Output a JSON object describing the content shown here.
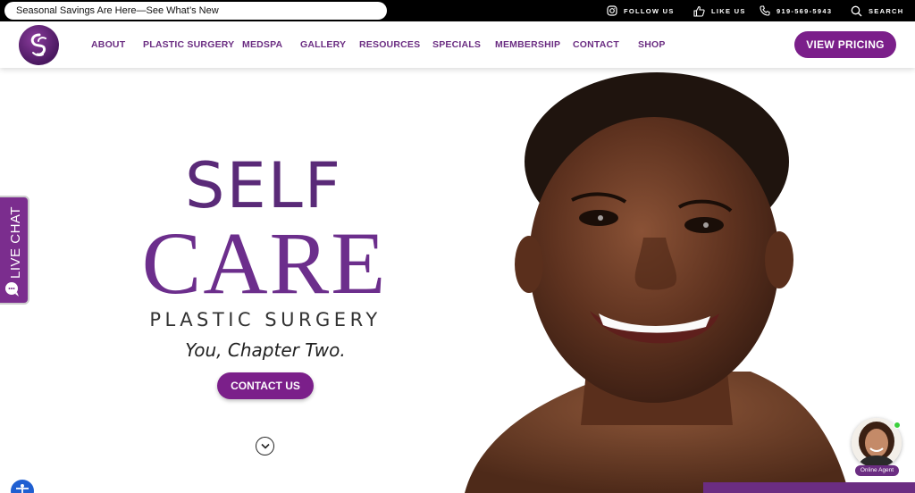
{
  "topbar": {
    "promo": "Seasonal Savings Are Here—See What’s New",
    "follow": "FOLLOW US",
    "like": "LIKE US",
    "phone": "919-569-5943",
    "search": "SEARCH"
  },
  "nav": {
    "items": [
      "ABOUT",
      "PLASTIC SURGERY",
      "MEDSPA",
      "GALLERY",
      "RESOURCES",
      "SPECIALS",
      "MEMBERSHIP",
      "CONTACT",
      "SHOP"
    ],
    "cta": "VIEW PRICING"
  },
  "hero": {
    "line1": "SELF",
    "line2": "CARE",
    "line3": "PLASTIC SURGERY",
    "tagline": "You, Chapter Two.",
    "cta": "CONTACT US"
  },
  "widgets": {
    "live_chat": "LIVE CHAT",
    "agent": "Online Agent"
  },
  "colors": {
    "brand": "#6b2d82",
    "button": "#7b1f8a",
    "topbar": "#000000"
  },
  "icons": [
    "instagram-icon",
    "thumbs-up-icon",
    "phone-icon",
    "search-icon",
    "chevron-down-icon",
    "chat-icon",
    "accessibility-icon"
  ]
}
